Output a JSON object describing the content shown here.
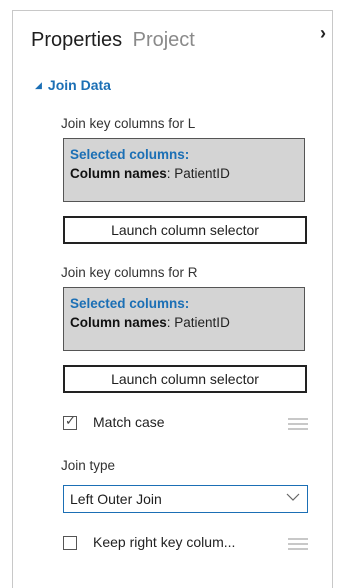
{
  "header": {
    "tabs": [
      {
        "label": "Properties",
        "active": true
      },
      {
        "label": "Project",
        "active": false
      }
    ],
    "collapse_icon": "chevron-right-icon"
  },
  "section": {
    "title": "Join Data",
    "expand_icon": "triangle-down-icon"
  },
  "join_left": {
    "label": "Join key columns for L",
    "selected_title": "Selected columns:",
    "column_names_label": "Column names",
    "column_names_value": ": PatientID",
    "button_label": "Launch column selector"
  },
  "join_right": {
    "label": "Join key columns for R",
    "selected_title": "Selected columns:",
    "column_names_label": "Column names",
    "column_names_value": ": PatientID",
    "button_label": "Launch column selector"
  },
  "match_case": {
    "label": "Match case",
    "checked": true
  },
  "join_type": {
    "label": "Join type",
    "selected": "Left Outer Join"
  },
  "keep_right": {
    "label": "Keep right key colum...",
    "checked": false
  },
  "colors": {
    "accent": "#1b6fb5",
    "selected_box_bg": "#d4d4d4",
    "inactive_tab": "#8a8a8a"
  }
}
